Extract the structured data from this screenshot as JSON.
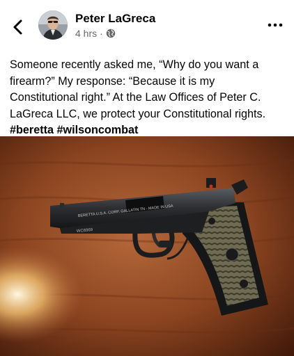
{
  "post": {
    "author": "Peter LaGreca",
    "time": "4 hrs",
    "separator": "·",
    "audience_icon": "globe-icon",
    "text_lines": [
      "Someone recently asked me, “Why do you want a",
      "firearm?” My response: “Because it is my",
      "Constitutional right.” At the Law Offices of Peter C.",
      "LaGreca LLC, we protect your Constitutional rights."
    ],
    "hashtags": [
      "#beretta",
      "#wilsoncombat"
    ],
    "photo": {
      "slide_engraving": "BERETTA U.S.A. CORP. GALLATIN TN - MADE IN USA",
      "frame_marking": "WC6969"
    }
  },
  "icons": {
    "back": "back-arrow-icon",
    "more": "more-options-icon"
  },
  "colors": {
    "text": "#050505",
    "secondary_text": "#65676b",
    "background": "#ffffff"
  }
}
